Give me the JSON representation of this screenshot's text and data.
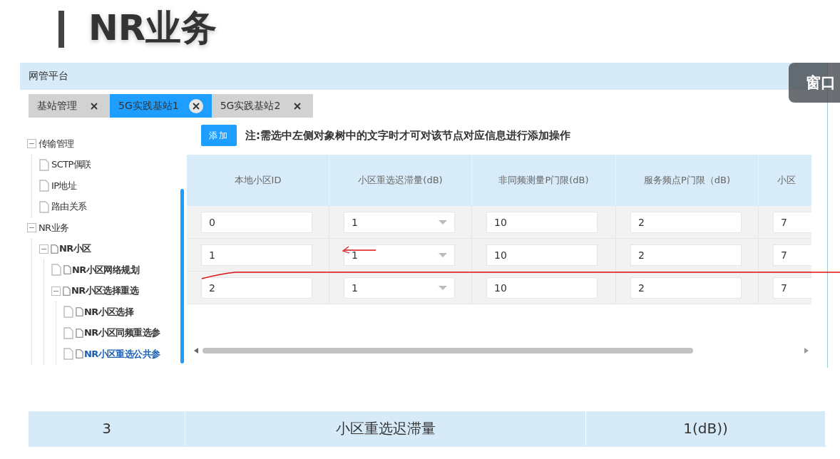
{
  "slide_title": "NR业务",
  "window": {
    "title": "网管平台"
  },
  "overlay_button": {
    "label": "窗口"
  },
  "tabs": [
    {
      "label": "基站管理",
      "selected": false
    },
    {
      "label": "5G实践基站1",
      "selected": true
    },
    {
      "label": "5G实践基站2",
      "selected": false
    }
  ],
  "tree": [
    {
      "label": "传输管理",
      "kind": "plain",
      "selected": false,
      "expanded": true,
      "children": [
        {
          "label": "SCTP偶联",
          "kind": "plain",
          "selected": false
        },
        {
          "label": "IP地址",
          "kind": "plain",
          "selected": false
        },
        {
          "label": "路由关系",
          "kind": "plain",
          "selected": false
        }
      ]
    },
    {
      "label": "NR业务",
      "kind": "plain",
      "selected": false,
      "expanded": true,
      "children": [
        {
          "label": "NR小区",
          "kind": "doc",
          "selected": false,
          "expanded": true,
          "children": [
            {
              "label": "NR小区网络规划",
              "kind": "doc",
              "selected": false
            },
            {
              "label": "NR小区选择重选",
              "kind": "doc",
              "selected": false,
              "expanded": true,
              "children": [
                {
                  "label": "NR小区选择",
                  "kind": "doc",
                  "selected": false
                },
                {
                  "label": "NR小区同频重选参",
                  "kind": "doc",
                  "selected": false
                },
                {
                  "label": "NR小区重选公共参",
                  "kind": "doc",
                  "selected": true
                }
              ]
            }
          ]
        }
      ]
    }
  ],
  "add_button": "添加",
  "note": "注:需选中左侧对象树中的文字时才可对该节点对应信息进行添加操作",
  "table": {
    "columns": [
      "本地小区ID",
      "小区重选迟滞量(dB)",
      "非同频测量P门限(dB)",
      "服务频点P门限（dB)",
      "小区"
    ],
    "rows": [
      [
        {
          "kind": "input",
          "value": "0"
        },
        {
          "kind": "select",
          "value": "1"
        },
        {
          "kind": "input",
          "value": "10"
        },
        {
          "kind": "input",
          "value": "2"
        },
        {
          "kind": "input",
          "value": "7"
        }
      ],
      [
        {
          "kind": "input",
          "value": "1"
        },
        {
          "kind": "select",
          "value": "1"
        },
        {
          "kind": "input",
          "value": "10"
        },
        {
          "kind": "input",
          "value": "2"
        },
        {
          "kind": "input",
          "value": "7"
        }
      ],
      [
        {
          "kind": "input",
          "value": "2"
        },
        {
          "kind": "select",
          "value": "1"
        },
        {
          "kind": "input",
          "value": "10"
        },
        {
          "kind": "input",
          "value": "2"
        },
        {
          "kind": "input",
          "value": "7"
        }
      ]
    ]
  },
  "summary_row": [
    "3",
    "小区重选迟滞量",
    "1(dB))"
  ]
}
